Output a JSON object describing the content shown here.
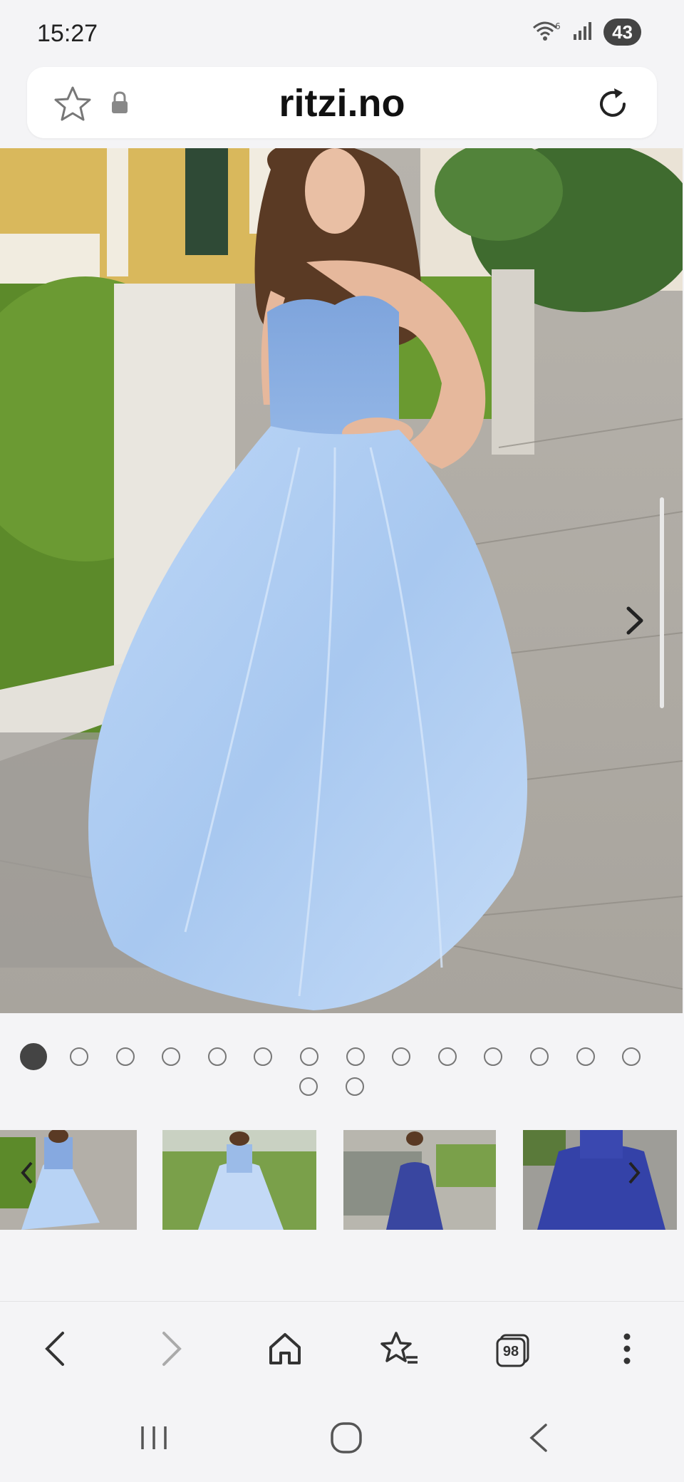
{
  "status_bar": {
    "time": "15:27",
    "battery": "43",
    "icons": [
      "wifi-6-icon",
      "signal-icon",
      "battery-icon"
    ]
  },
  "browser": {
    "url": "ritzi.no",
    "icons": [
      "favorite-star-icon",
      "lock-icon",
      "reload-icon"
    ]
  },
  "gallery": {
    "image_description": "product photo of light blue strapless ball gown",
    "dots_total": 16,
    "active_dot": 1
  },
  "thumbnails": [
    {
      "name": "light-blue-gown-street"
    },
    {
      "name": "light-blue-gown-garden"
    },
    {
      "name": "royal-blue-gown-park"
    },
    {
      "name": "royal-blue-gown-road"
    }
  ],
  "bottom_nav": [
    "back-icon",
    "forward-icon",
    "home-icon",
    "bookmarks-icon",
    "tabs-icon",
    "more-icon"
  ],
  "tabs_count": "98",
  "system_nav": [
    "recents-icon",
    "home-circle-icon",
    "system-back-icon"
  ],
  "colors": {
    "background": "#f4f4f6",
    "accent_dark": "#444444",
    "dress": "#a9c9f2"
  }
}
